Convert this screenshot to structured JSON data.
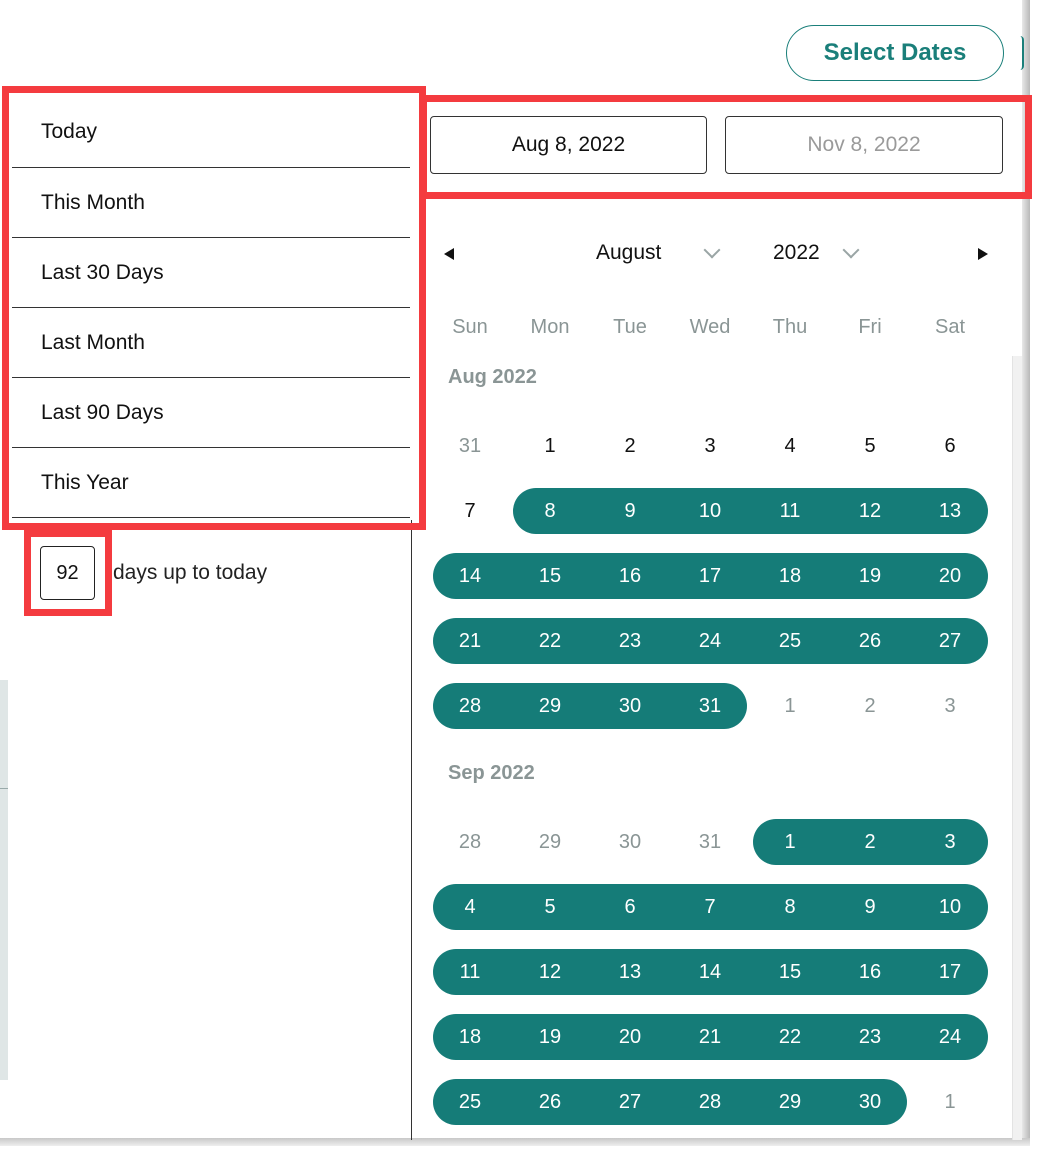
{
  "header": {
    "select_dates_label": "Select Dates"
  },
  "presets": [
    "Today",
    "This Month",
    "Last 30 Days",
    "Last Month",
    "Last 90 Days",
    "This Year"
  ],
  "days_input": {
    "value": "92",
    "suffix": "days up to today"
  },
  "date_range": {
    "start": "Aug 8, 2022",
    "end": "Nov 8, 2022"
  },
  "nav": {
    "month": "August",
    "year": "2022"
  },
  "weekdays": [
    "Sun",
    "Mon",
    "Tue",
    "Wed",
    "Thu",
    "Fri",
    "Sat"
  ],
  "colors": {
    "accent": "#157c78",
    "highlight": "#f43b3f"
  },
  "months": [
    {
      "label": "Aug 2022",
      "weeks": [
        [
          {
            "d": "31",
            "s": "out"
          },
          {
            "d": "1",
            "s": "cur"
          },
          {
            "d": "2",
            "s": "cur"
          },
          {
            "d": "3",
            "s": "cur"
          },
          {
            "d": "4",
            "s": "cur"
          },
          {
            "d": "5",
            "s": "cur"
          },
          {
            "d": "6",
            "s": "cur"
          }
        ],
        [
          {
            "d": "7",
            "s": "cur"
          },
          {
            "d": "8",
            "s": "in"
          },
          {
            "d": "9",
            "s": "in"
          },
          {
            "d": "10",
            "s": "in"
          },
          {
            "d": "11",
            "s": "in"
          },
          {
            "d": "12",
            "s": "in"
          },
          {
            "d": "13",
            "s": "in"
          }
        ],
        [
          {
            "d": "14",
            "s": "in"
          },
          {
            "d": "15",
            "s": "in"
          },
          {
            "d": "16",
            "s": "in"
          },
          {
            "d": "17",
            "s": "in"
          },
          {
            "d": "18",
            "s": "in"
          },
          {
            "d": "19",
            "s": "in"
          },
          {
            "d": "20",
            "s": "in"
          }
        ],
        [
          {
            "d": "21",
            "s": "in"
          },
          {
            "d": "22",
            "s": "in"
          },
          {
            "d": "23",
            "s": "in"
          },
          {
            "d": "24",
            "s": "in"
          },
          {
            "d": "25",
            "s": "in"
          },
          {
            "d": "26",
            "s": "in"
          },
          {
            "d": "27",
            "s": "in"
          }
        ],
        [
          {
            "d": "28",
            "s": "in"
          },
          {
            "d": "29",
            "s": "in"
          },
          {
            "d": "30",
            "s": "in"
          },
          {
            "d": "31",
            "s": "in"
          },
          {
            "d": "1",
            "s": "out"
          },
          {
            "d": "2",
            "s": "out"
          },
          {
            "d": "3",
            "s": "out"
          }
        ]
      ]
    },
    {
      "label": "Sep 2022",
      "weeks": [
        [
          {
            "d": "28",
            "s": "out"
          },
          {
            "d": "29",
            "s": "out"
          },
          {
            "d": "30",
            "s": "out"
          },
          {
            "d": "31",
            "s": "out"
          },
          {
            "d": "1",
            "s": "in"
          },
          {
            "d": "2",
            "s": "in"
          },
          {
            "d": "3",
            "s": "in"
          }
        ],
        [
          {
            "d": "4",
            "s": "in"
          },
          {
            "d": "5",
            "s": "in"
          },
          {
            "d": "6",
            "s": "in"
          },
          {
            "d": "7",
            "s": "in"
          },
          {
            "d": "8",
            "s": "in"
          },
          {
            "d": "9",
            "s": "in"
          },
          {
            "d": "10",
            "s": "in"
          }
        ],
        [
          {
            "d": "11",
            "s": "in"
          },
          {
            "d": "12",
            "s": "in"
          },
          {
            "d": "13",
            "s": "in"
          },
          {
            "d": "14",
            "s": "in"
          },
          {
            "d": "15",
            "s": "in"
          },
          {
            "d": "16",
            "s": "in"
          },
          {
            "d": "17",
            "s": "in"
          }
        ],
        [
          {
            "d": "18",
            "s": "in"
          },
          {
            "d": "19",
            "s": "in"
          },
          {
            "d": "20",
            "s": "in"
          },
          {
            "d": "21",
            "s": "in"
          },
          {
            "d": "22",
            "s": "in"
          },
          {
            "d": "23",
            "s": "in"
          },
          {
            "d": "24",
            "s": "in"
          }
        ],
        [
          {
            "d": "25",
            "s": "in"
          },
          {
            "d": "26",
            "s": "in"
          },
          {
            "d": "27",
            "s": "in"
          },
          {
            "d": "28",
            "s": "in"
          },
          {
            "d": "29",
            "s": "in"
          },
          {
            "d": "30",
            "s": "in"
          },
          {
            "d": "1",
            "s": "out"
          }
        ]
      ]
    }
  ]
}
